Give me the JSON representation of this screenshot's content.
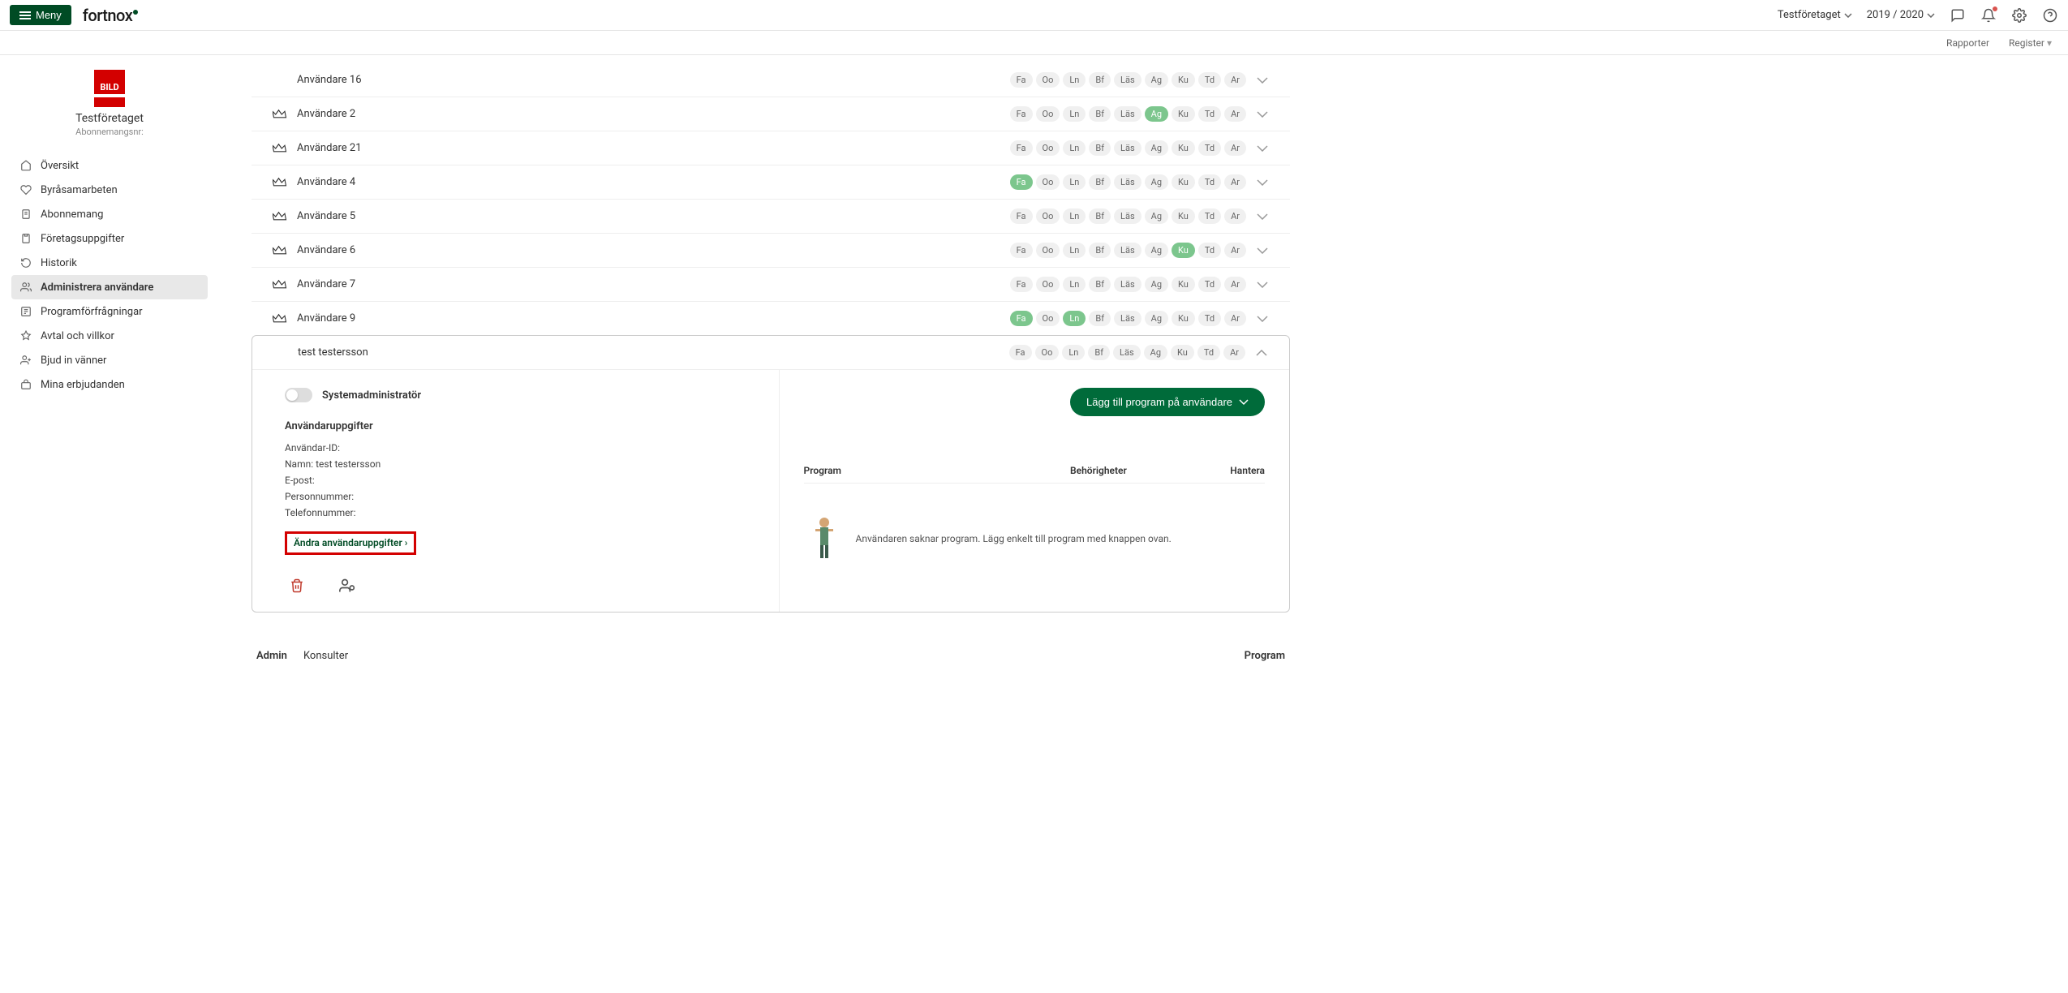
{
  "topbar": {
    "menu_label": "Meny",
    "logo_text": "fortnox",
    "company": "Testföretaget",
    "period": "2019 / 2020"
  },
  "secbar": {
    "reports": "Rapporter",
    "register": "Register"
  },
  "sidebar": {
    "company_name": "Testföretaget",
    "subscription_label": "Abonnemangsnr:",
    "items": [
      {
        "label": "Översikt"
      },
      {
        "label": "Byråsamarbeten"
      },
      {
        "label": "Abonnemang"
      },
      {
        "label": "Företagsuppgifter"
      },
      {
        "label": "Historik"
      },
      {
        "label": "Administrera användare"
      },
      {
        "label": "Programförfrågningar"
      },
      {
        "label": "Avtal och villkor"
      },
      {
        "label": "Bjud in vänner"
      },
      {
        "label": "Mina erbjudanden"
      }
    ]
  },
  "pill_labels": [
    "Fa",
    "Oo",
    "Ln",
    "Bf",
    "Läs",
    "Ag",
    "Ku",
    "Td",
    "Ar"
  ],
  "users": [
    {
      "name": "Användare 16",
      "crown": false,
      "active": []
    },
    {
      "name": "Användare 2",
      "crown": true,
      "active": [
        "Ag"
      ]
    },
    {
      "name": "Användare 21",
      "crown": true,
      "active": []
    },
    {
      "name": "Användare 4",
      "crown": true,
      "active": [
        "Fa"
      ]
    },
    {
      "name": "Användare 5",
      "crown": true,
      "active": []
    },
    {
      "name": "Användare 6",
      "crown": true,
      "active": [
        "Ku"
      ]
    },
    {
      "name": "Användare 7",
      "crown": true,
      "active": []
    },
    {
      "name": "Användare 9",
      "crown": true,
      "active": [
        "Fa",
        "Ln"
      ]
    }
  ],
  "expanded": {
    "name": "test testersson",
    "crown": false,
    "active": [],
    "toggle_label": "Systemadministratör",
    "section_header": "Användaruppgifter",
    "lines": {
      "id_label": "Användar-ID:",
      "name_label": "Namn: test testersson",
      "email_label": "E-post:",
      "pnr_label": "Personnummer:",
      "tel_label": "Telefonnummer:"
    },
    "edit_link": "Ändra användaruppgifter ›",
    "add_program_btn": "Lägg till program på användare",
    "cols": {
      "c1": "Program",
      "c2": "Behörigheter",
      "c3": "Hantera"
    },
    "empty_text": "Användaren saknar program. Lägg enkelt till program med knappen ovan."
  },
  "footer": {
    "admin": "Admin",
    "consultants": "Konsulter",
    "program": "Program"
  }
}
